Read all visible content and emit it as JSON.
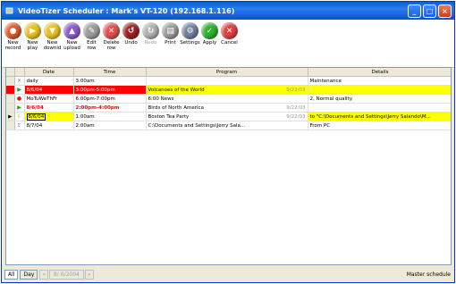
{
  "window": {
    "title": "VideoTizer Scheduler : Mark's VT-120 (192.168.1.116)"
  },
  "toolbar": {
    "buttons": [
      {
        "label": "New\nrecord",
        "color": "#e05a2a",
        "icon": "record-icon",
        "enabled": true
      },
      {
        "label": "New\nplay",
        "color": "#e8c020",
        "icon": "play-icon",
        "enabled": true
      },
      {
        "label": "New\ndownld",
        "color": "#e8c020",
        "icon": "download-icon",
        "enabled": true
      },
      {
        "label": "New\nupload",
        "color": "#8a5ad0",
        "icon": "upload-icon",
        "enabled": true
      },
      {
        "label": "Edit row",
        "color": "#9a9a9a",
        "icon": "edit-icon",
        "enabled": true
      },
      {
        "label": "Delete\nrow",
        "color": "#e05050",
        "icon": "delete-icon",
        "enabled": true
      },
      {
        "label": "Undo",
        "color": "#a02020",
        "icon": "undo-icon",
        "enabled": true
      },
      {
        "label": "Redo",
        "color": "#b0b0b0",
        "icon": "redo-icon",
        "enabled": false
      },
      {
        "label": "Print",
        "color": "#9a9a9a",
        "icon": "print-icon",
        "enabled": true
      },
      {
        "label": "Settings",
        "color": "#7080a0",
        "icon": "settings-icon",
        "enabled": true
      },
      {
        "label": "Apply",
        "color": "#30b030",
        "icon": "apply-icon",
        "enabled": true
      },
      {
        "label": "Cancel",
        "color": "#e04040",
        "icon": "cancel-icon",
        "enabled": true
      }
    ]
  },
  "grid": {
    "columns": {
      "date": "Date",
      "time": "Time",
      "program": "Program",
      "details": "Details"
    },
    "rows": [
      {
        "marker": "×",
        "marker_color": "#707070",
        "date": "daily",
        "time": "3:00am",
        "program": "",
        "program_date": "",
        "details": "Maintenance"
      },
      {
        "marker": "▶",
        "marker_color": "#20a020",
        "date": "8/6/04",
        "time": "3:00pm-5:00pm",
        "program": "Volcanoes of the World",
        "program_date": "9/22/03",
        "details": ""
      },
      {
        "marker": "●",
        "marker_color": "#ff0000",
        "date": "MoTuWeThFr",
        "time": "6:00pm-7:00pm",
        "program": "6:00 News",
        "program_date": "",
        "details": "2, Normal quality"
      },
      {
        "marker": "▶",
        "marker_color": "#20a020",
        "date": "8/6/04",
        "time": "2:00pm-4:00pm",
        "program": "Birds of North America",
        "program_date": "9/22/03",
        "details": ""
      },
      {
        "marker": "⇩",
        "marker_color": "#e8a000",
        "date": "8/6/04",
        "time": "1:00am",
        "program": "Boston Tea Party",
        "program_date": "9/22/03",
        "details": "to \"C:\\Documents and Settings\\Jerry Salando\\M..."
      },
      {
        "marker": "⇧",
        "marker_color": "#8a30c0",
        "date": "8/7/04",
        "time": "2:00am",
        "program": "C:\\Documents and Settings\\Jerry Sala...",
        "program_date": "",
        "details": "From PC"
      }
    ]
  },
  "statusbar": {
    "tab_all": "All",
    "tab_day": "Day",
    "prev": "«",
    "date": "8/ 6/2004",
    "next": "»",
    "right": "Master schedule"
  },
  "colors": {
    "highlight_red": "#ff0000",
    "highlight_yellow": "#ffff00",
    "title_blue": "#0a5fd8"
  }
}
